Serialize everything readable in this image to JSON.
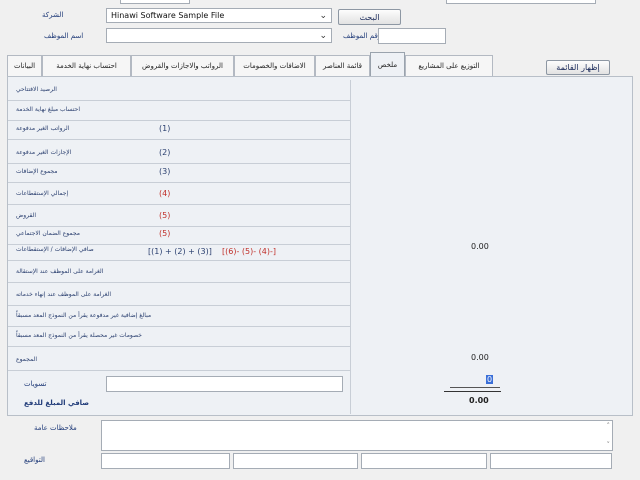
{
  "header": {
    "company_label": "الشركة",
    "company_value": "Hinawi Software Sample File",
    "search_button": "البحث",
    "employee_name_label": "اسم الموظف",
    "employee_name_value": "",
    "employee_no_label": "رقم الموظف",
    "employee_no_value": ""
  },
  "tabs": [
    {
      "label": "التوزيع على المشاريع"
    },
    {
      "label": "ملخص"
    },
    {
      "label": "قائمة العناصر"
    },
    {
      "label": "الاضافات والخصومات"
    },
    {
      "label": "الرواتب والاجازات والقروض"
    },
    {
      "label": "احتساب نهاية الخدمة"
    },
    {
      "label": "البيانات"
    }
  ],
  "show_list_button": "إظهار القائمة",
  "summary": {
    "rows": [
      {
        "label": "الرصيد الافتتاحي",
        "num": "",
        "red": false
      },
      {
        "label": "احتساب مبلغ نهاية الخدمة",
        "num": "",
        "red": false
      },
      {
        "label": "الرواتب الغير مدفوعة",
        "num": "(1)",
        "red": false
      },
      {
        "label": "الإجازات الغير مدفوعة",
        "num": "(2)",
        "red": false
      },
      {
        "label": "مجموع الإضافات",
        "num": "(3)",
        "red": false
      },
      {
        "label": "إجمالي الإستقطاعات",
        "num": "(4)",
        "red": true
      },
      {
        "label": "القروض",
        "num": "(5)",
        "red": true
      },
      {
        "label": "مجموع الضمان الاجتماعي",
        "num": "(5)",
        "red": true
      },
      {
        "label": "صافي الإضافات / الإستقطاعات",
        "num": "",
        "red": false
      },
      {
        "label": "الغرامة على الموظف عند الإستقالة",
        "num": "",
        "red": false
      },
      {
        "label": "الغرامة على الموظف عند إنهاء خدماته",
        "num": "",
        "red": false
      },
      {
        "label": "مبالغ إضافية غير مدفوعة يقرأ من النموذج المعد مسبقاً",
        "num": "",
        "red": false
      },
      {
        "label": "خصومات غير محصلة يقرأ من النموذج المعد مسبقاً",
        "num": "",
        "red": false
      }
    ],
    "formula_black": "[(1) + (2) + (3)]",
    "formula_red": "[(6)- (5)- (4)-]",
    "net_value": "0.00",
    "total_label": "المجموع",
    "total_value": "0.00",
    "adjustments_label": "تسويات",
    "adjustments_value": "0",
    "net_payable_label": "صافي المبلغ للدفع",
    "net_payable_value": "0.00"
  },
  "footer": {
    "general_notes_label": "ملاحظات عامة",
    "signature_label": "التواقيع"
  }
}
